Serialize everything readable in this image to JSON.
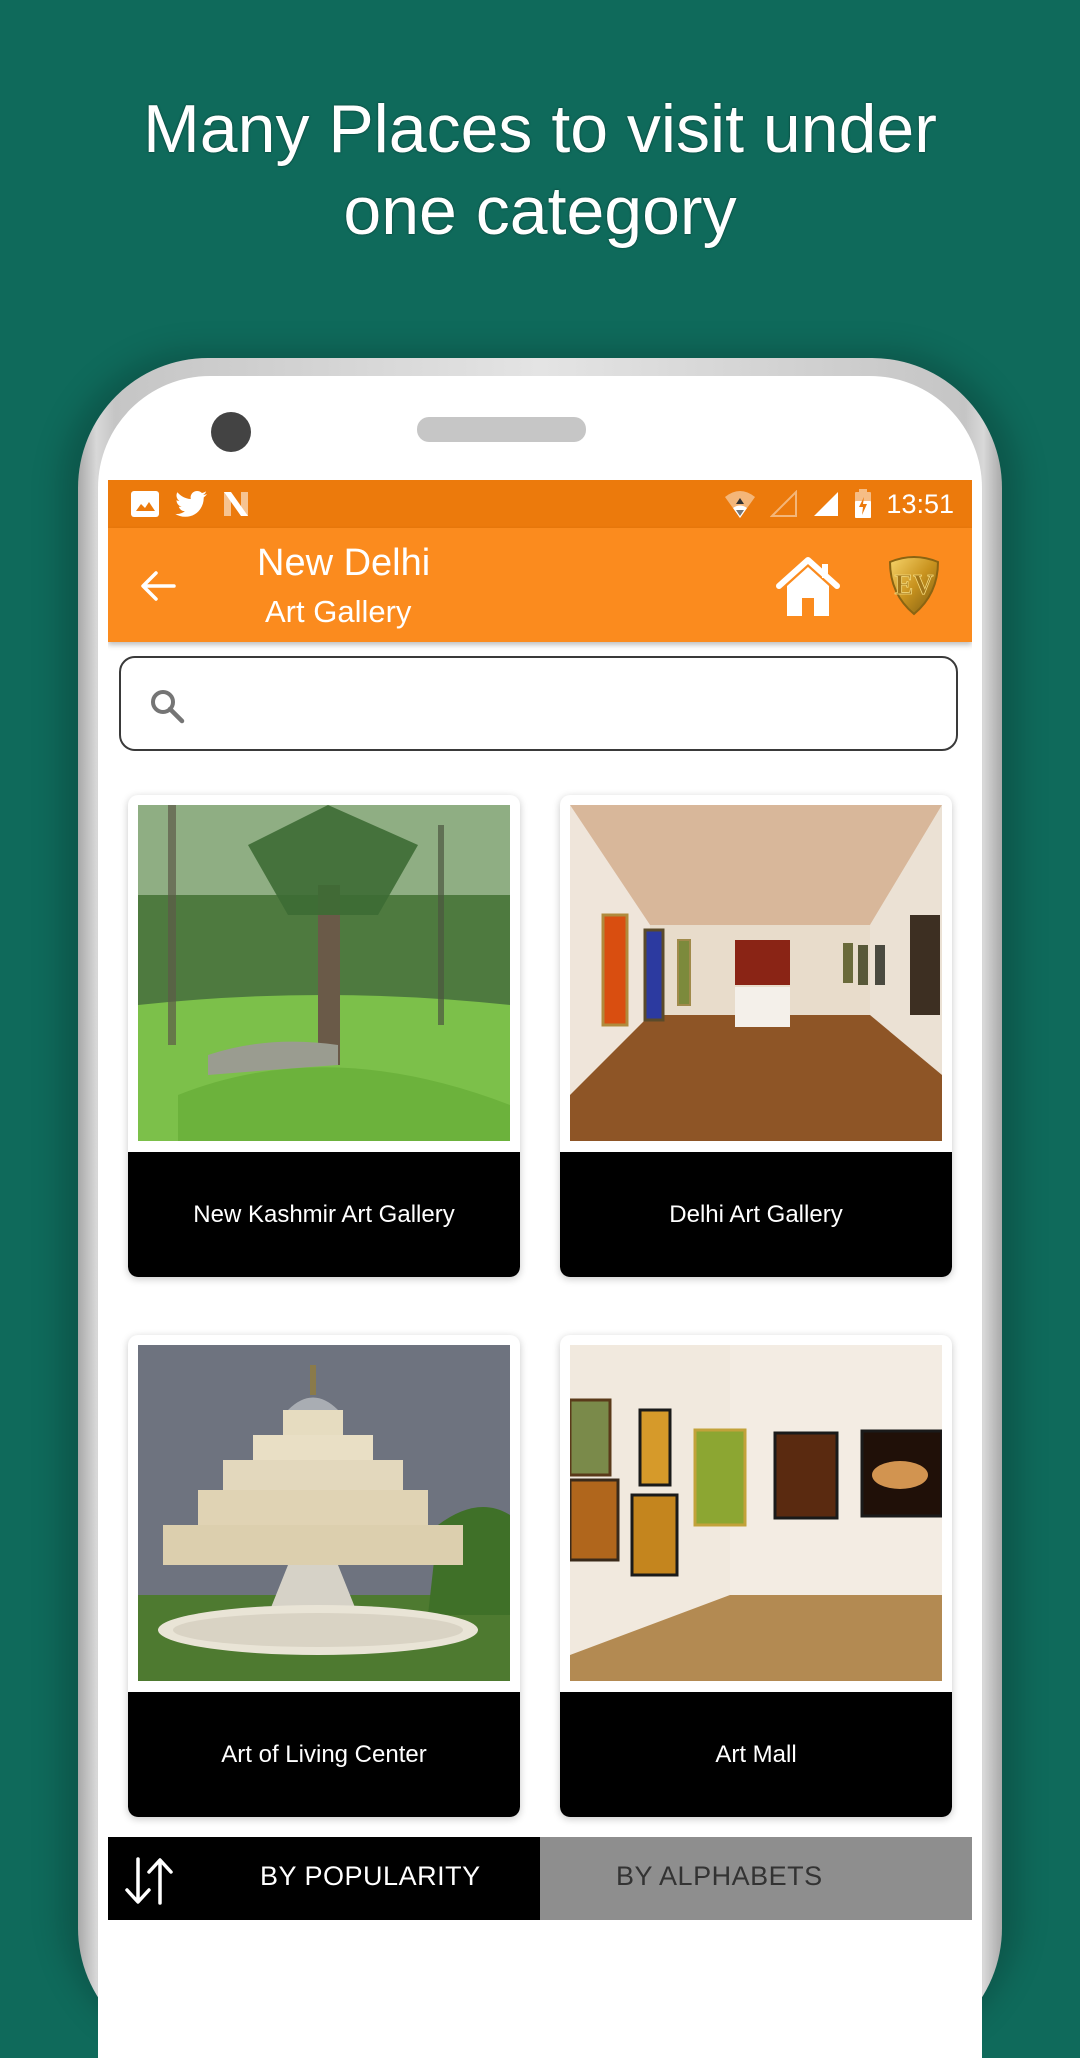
{
  "promo": {
    "line1": "Many Places to visit under",
    "line2": "one category"
  },
  "status_bar": {
    "left_icons": [
      "gallery-icon",
      "twitter-icon",
      "n-app-icon"
    ],
    "right_icons": [
      "wifi-icon",
      "signal-empty-icon",
      "signal-icon",
      "battery-charging-icon"
    ],
    "time": "13:51",
    "color": "#ec7a0c"
  },
  "app_bar": {
    "title": "New Delhi",
    "subtitle": "Art Gallery",
    "back_icon": "arrow-left-icon",
    "home_icon": "home-icon",
    "logo": "EV",
    "color": "#fb8b1e"
  },
  "search": {
    "value": "",
    "placeholder": "",
    "icon": "search-icon"
  },
  "places": [
    {
      "name": "New Kashmir Art Gallery",
      "image": "forest meadow with pine trees"
    },
    {
      "name": "Delhi Art Gallery",
      "image": "gallery hall with paintings and wooden floor"
    },
    {
      "name": "Art of Living Center",
      "image": "tiered white domed building with fountain"
    },
    {
      "name": "Art Mall",
      "image": "gallery corner with framed paintings"
    }
  ],
  "sort_bar": {
    "icon": "sort-arrows-icon",
    "options": [
      {
        "label": "BY POPULARITY",
        "selected": true
      },
      {
        "label": "BY ALPHABETS",
        "selected": false
      }
    ]
  },
  "colors": {
    "background": "#0f6a5b",
    "accent": "#fb8b1e",
    "card_label_bg": "#000000",
    "inactive_tab": "#8e8e8e"
  }
}
